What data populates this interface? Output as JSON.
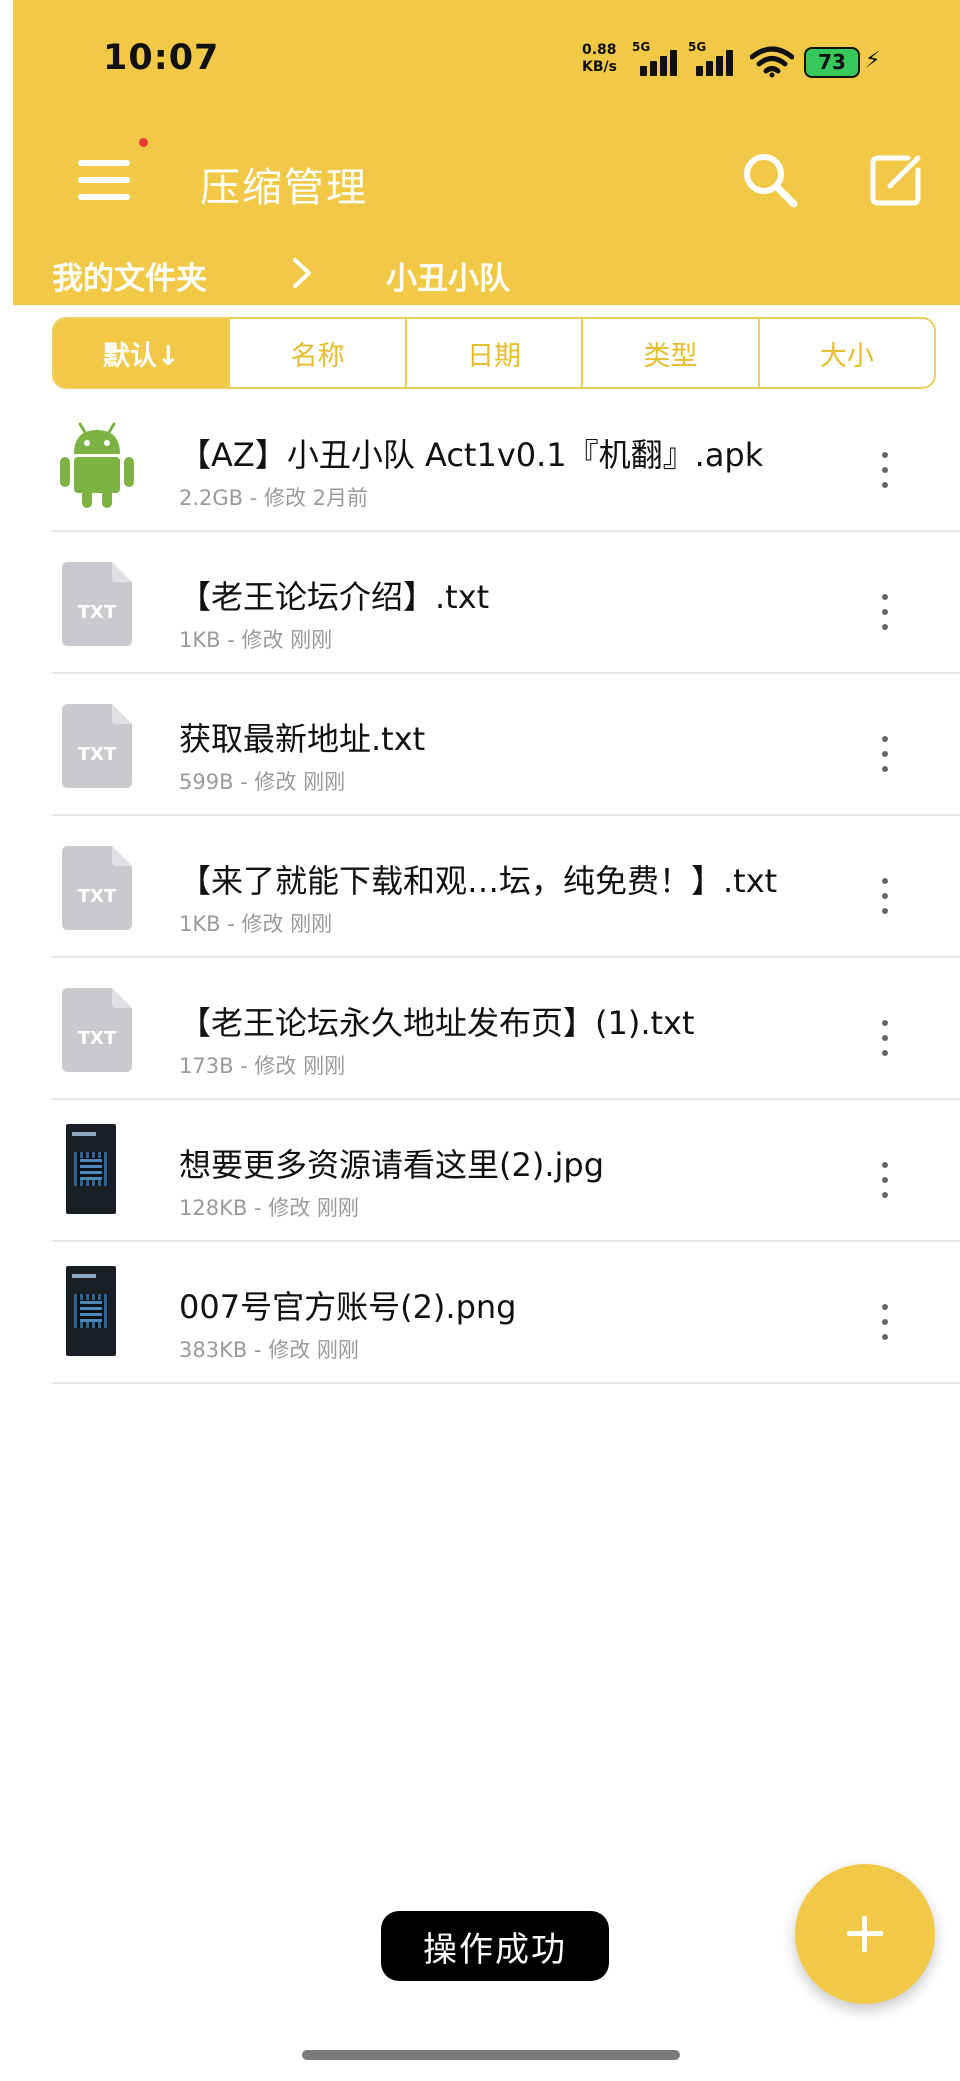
{
  "status_bar": {
    "time": "10:07",
    "net_speed_value": "0.88",
    "net_speed_unit": "KB/s",
    "sim1_label": "5G",
    "sim2_label": "5G",
    "battery": "73"
  },
  "app_bar": {
    "title": "压缩管理",
    "menu_icon": "hamburger-menu-icon",
    "search_icon": "search-icon",
    "edit_icon": "edit-icon"
  },
  "breadcrumb": {
    "root": "我的文件夹",
    "current": "小丑小队"
  },
  "sort_tabs": [
    {
      "label": "默认↓"
    },
    {
      "label": "名称"
    },
    {
      "label": "日期"
    },
    {
      "label": "类型"
    },
    {
      "label": "大小"
    }
  ],
  "files": [
    {
      "name": "【AZ】小丑小队 Act1v0.1『机翻』.apk",
      "meta": "2.2GB - 修改 2月前",
      "icon": "android-icon"
    },
    {
      "name": "【老王论坛介绍】.txt",
      "meta": "1KB - 修改 刚刚",
      "icon": "txt-file-icon",
      "icon_label": "TXT"
    },
    {
      "name": "获取最新地址.txt",
      "meta": "599B - 修改 刚刚",
      "icon": "txt-file-icon",
      "icon_label": "TXT"
    },
    {
      "name": "【来了就能下载和观…坛，纯免费！】.txt",
      "meta": "1KB - 修改 刚刚",
      "icon": "txt-file-icon",
      "icon_label": "TXT"
    },
    {
      "name": "【老王论坛永久地址发布页】(1).txt",
      "meta": "173B - 修改 刚刚",
      "icon": "txt-file-icon",
      "icon_label": "TXT"
    },
    {
      "name": "想要更多资源请看这里(2).jpg",
      "meta": "128KB - 修改 刚刚",
      "icon": "image-thumbnail"
    },
    {
      "name": "007号官方账号(2).png",
      "meta": "383KB - 修改 刚刚",
      "icon": "image-thumbnail"
    }
  ],
  "toast": "操作成功",
  "colors": {
    "accent": "#f1c946",
    "accent_text": "#e8bd2b",
    "android_green": "#7cb342",
    "txt_icon_gray": "#c9cace"
  }
}
